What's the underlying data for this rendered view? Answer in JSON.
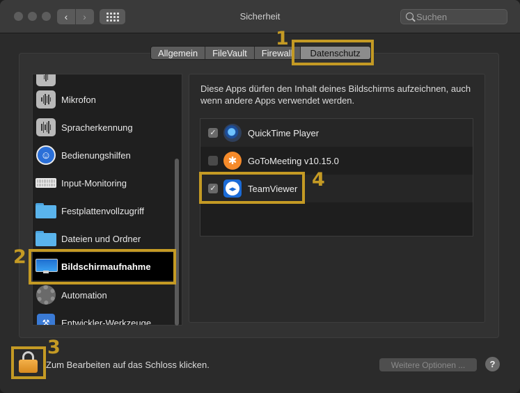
{
  "window": {
    "title": "Sicherheit"
  },
  "search": {
    "placeholder": "Suchen"
  },
  "nav": {
    "back": "‹",
    "forward": "›"
  },
  "tabs": [
    "Allgemein",
    "FileVault",
    "Firewall",
    "Datenschutz"
  ],
  "active_tab": "Datenschutz",
  "sidebar": {
    "items": [
      {
        "label": "",
        "icon": "microphone-icon"
      },
      {
        "label": "Mikrofon",
        "icon": "microphone-icon"
      },
      {
        "label": "Spracherkennung",
        "icon": "speech-recognition-icon"
      },
      {
        "label": "Bedienungshilfen",
        "icon": "accessibility-icon"
      },
      {
        "label": "Input-Monitoring",
        "icon": "keyboard-icon"
      },
      {
        "label": "Festplattenvollzugriff",
        "icon": "folder-icon"
      },
      {
        "label": "Dateien und Ordner",
        "icon": "folder-icon"
      },
      {
        "label": "Bildschirmaufnahme",
        "icon": "display-icon",
        "selected": true
      },
      {
        "label": "Automation",
        "icon": "gear-icon"
      },
      {
        "label": "Entwickler-Werkzeuge",
        "icon": "developer-tools-icon"
      }
    ]
  },
  "panel": {
    "description": "Diese Apps dürfen den Inhalt deines Bildschirms aufzeichnen, auch wenn andere Apps verwendet werden.",
    "apps": [
      {
        "name": "QuickTime Player",
        "checked": true,
        "icon": "quicktime-icon"
      },
      {
        "name": "GoToMeeting v10.15.0",
        "checked": false,
        "icon": "gotomeeting-icon"
      },
      {
        "name": "TeamViewer",
        "checked": true,
        "icon": "teamviewer-icon"
      }
    ]
  },
  "footer": {
    "lock_text": "Zum Bearbeiten auf das Schloss klicken.",
    "more_options": "Weitere Optionen ...",
    "help": "?"
  },
  "annotations": [
    "1",
    "2",
    "3",
    "4"
  ],
  "colors": {
    "annotation": "#c49a24",
    "accent": "#1b6bd6"
  }
}
